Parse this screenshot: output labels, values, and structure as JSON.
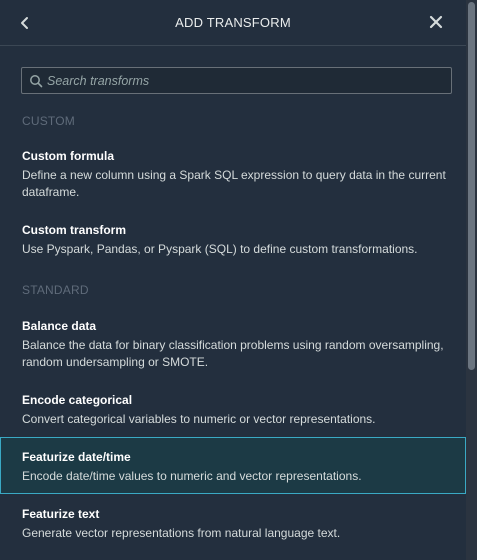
{
  "header": {
    "title": "ADD TRANSFORM",
    "back_icon": "chevron-left-icon",
    "close_icon": "close-icon"
  },
  "search": {
    "placeholder": "Search transforms",
    "value": "",
    "icon": "search-icon"
  },
  "sections": {
    "custom": {
      "label": "CUSTOM",
      "items": [
        {
          "title": "Custom formula",
          "description": "Define a new column using a Spark SQL expression to query data in the current dataframe."
        },
        {
          "title": "Custom transform",
          "description": "Use Pyspark, Pandas, or Pyspark (SQL) to define custom transformations."
        }
      ]
    },
    "standard": {
      "label": "STANDARD",
      "items": [
        {
          "title": "Balance data",
          "description": "Balance the data for binary classification problems using random oversampling, random undersampling or SMOTE."
        },
        {
          "title": "Encode categorical",
          "description": "Convert categorical variables to numeric or vector representations."
        },
        {
          "title": "Featurize date/time",
          "description": "Encode date/time values to numeric and vector representations.",
          "selected": true
        },
        {
          "title": "Featurize text",
          "description": "Generate vector representations from natural language text."
        }
      ]
    }
  },
  "colors": {
    "background": "#232f3e",
    "selected_border": "#3aa9c4",
    "selected_background": "#1c3a45",
    "section_label": "#5f6b7a"
  }
}
